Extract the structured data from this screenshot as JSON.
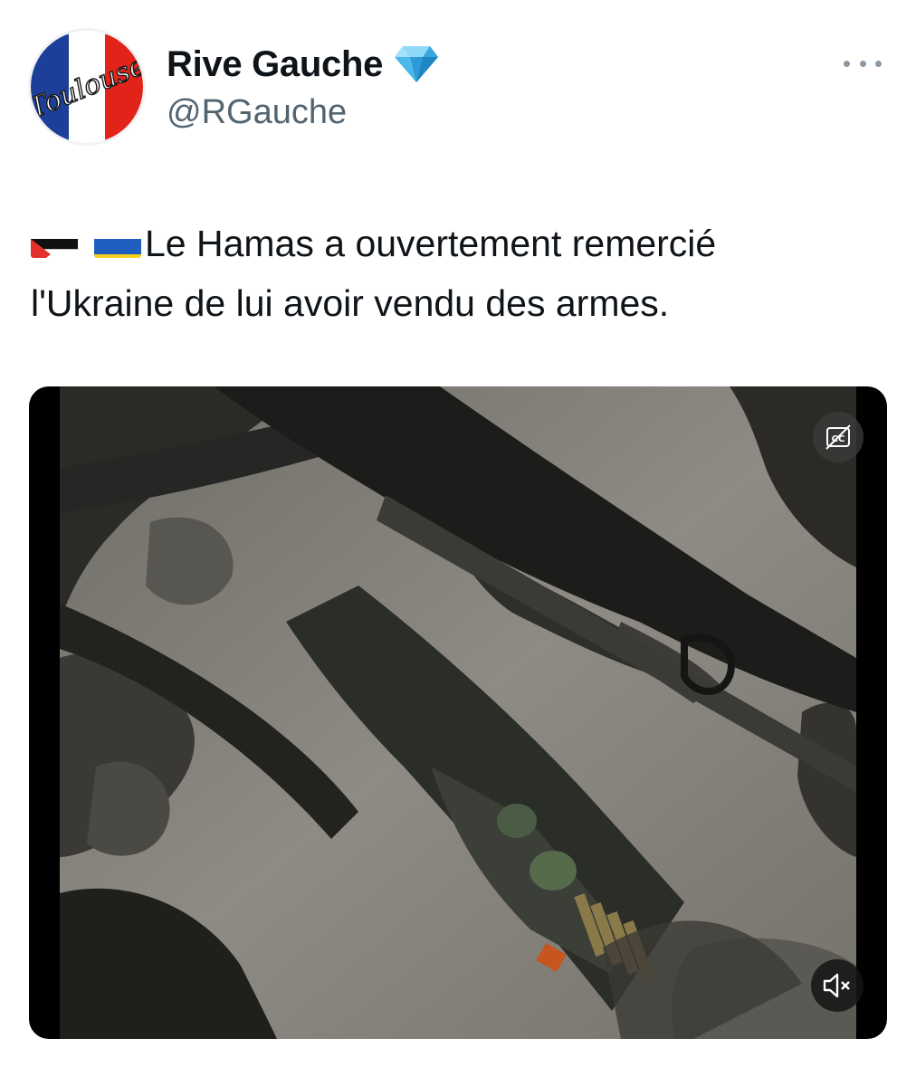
{
  "author": {
    "display_name": "Rive Gauche",
    "handle": "@RGauche",
    "avatar_text": "Toulouse",
    "verified_icon": "diamond-badge-icon"
  },
  "tweet": {
    "flags": [
      "palestine-flag-icon",
      "ukraine-flag-icon"
    ],
    "line1": "Le Hamas a ouvertement remercié",
    "line2": "l'Ukraine de lui avoir vendu des armes."
  },
  "media": {
    "type": "video",
    "cc_icon": "closed-captions-icon",
    "mute_icon": "speaker-muted-icon"
  },
  "colors": {
    "text_primary": "#0f1419",
    "text_secondary": "#536471",
    "verified": "#55c8f0"
  }
}
